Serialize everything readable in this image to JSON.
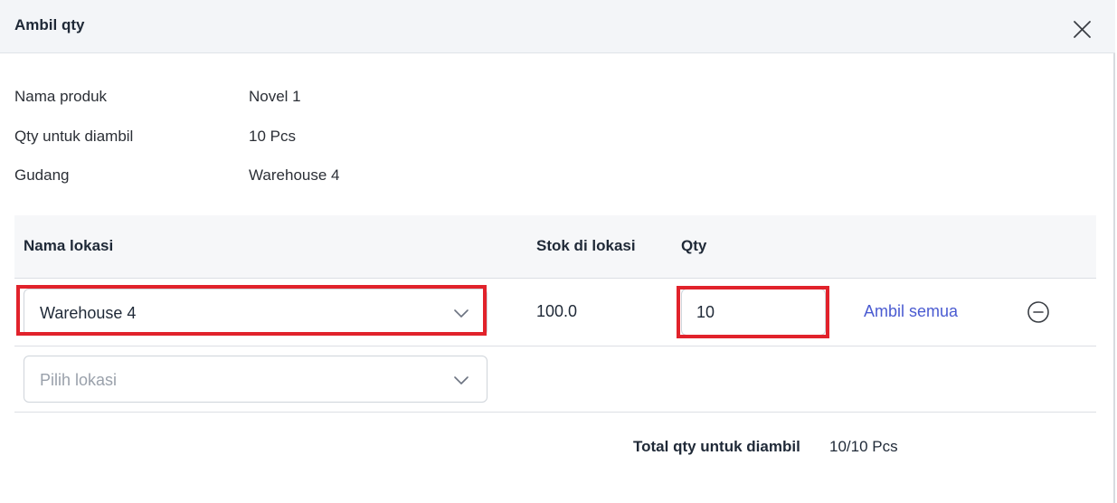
{
  "modal": {
    "title": "Ambil qty"
  },
  "info": {
    "product_label": "Nama produk",
    "product_value": "Novel 1",
    "qty_label": "Qty untuk diambil",
    "qty_value": "10 Pcs",
    "warehouse_label": "Gudang",
    "warehouse_value": "Warehouse 4"
  },
  "table": {
    "headers": {
      "location": "Nama lokasi",
      "stock": "Stok di lokasi",
      "qty": "Qty"
    },
    "rows": [
      {
        "location": "Warehouse 4",
        "stock": "100.0",
        "qty": "10",
        "take_all_label": "Ambil semua"
      }
    ],
    "new_row": {
      "placeholder": "Pilih lokasi"
    }
  },
  "summary": {
    "total_label": "Total qty untuk diambil",
    "total_value": "10/10 Pcs"
  },
  "colors": {
    "header_bg": "#f3f5f8",
    "highlight": "#e1222b",
    "link": "#4a5bd1"
  },
  "icons": {
    "close": "close-icon",
    "chevron": "chevron-down-icon",
    "remove": "minus-circle-icon"
  }
}
